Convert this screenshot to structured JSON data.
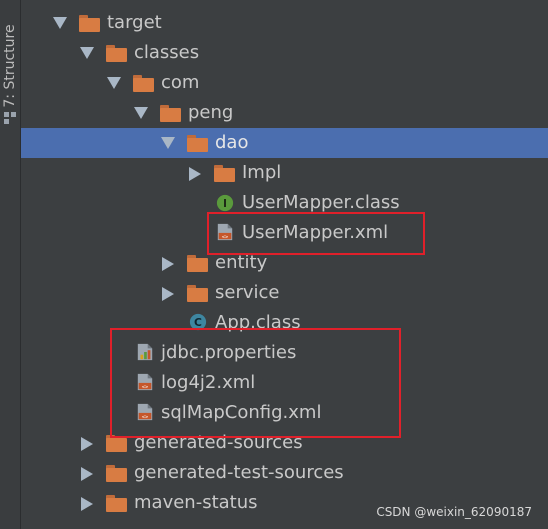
{
  "side_tab": {
    "label": "7: Structure"
  },
  "tree": {
    "items": [
      {
        "label": "target"
      },
      {
        "label": "classes"
      },
      {
        "label": "com"
      },
      {
        "label": "peng"
      },
      {
        "label": "dao"
      },
      {
        "label": "Impl"
      },
      {
        "label": "UserMapper.class"
      },
      {
        "label": "UserMapper.xml"
      },
      {
        "label": "entity"
      },
      {
        "label": "service"
      },
      {
        "label": "App.class"
      },
      {
        "label": "jdbc.properties"
      },
      {
        "label": "log4j2.xml"
      },
      {
        "label": "sqlMapConfig.xml"
      },
      {
        "label": "generated-sources"
      },
      {
        "label": "generated-test-sources"
      },
      {
        "label": "maven-status"
      }
    ]
  },
  "colors": {
    "selection": "#4b6eaf",
    "highlight_box": "#e0202a",
    "folder": "#d87c43"
  },
  "watermark": "CSDN @weixin_62090187"
}
